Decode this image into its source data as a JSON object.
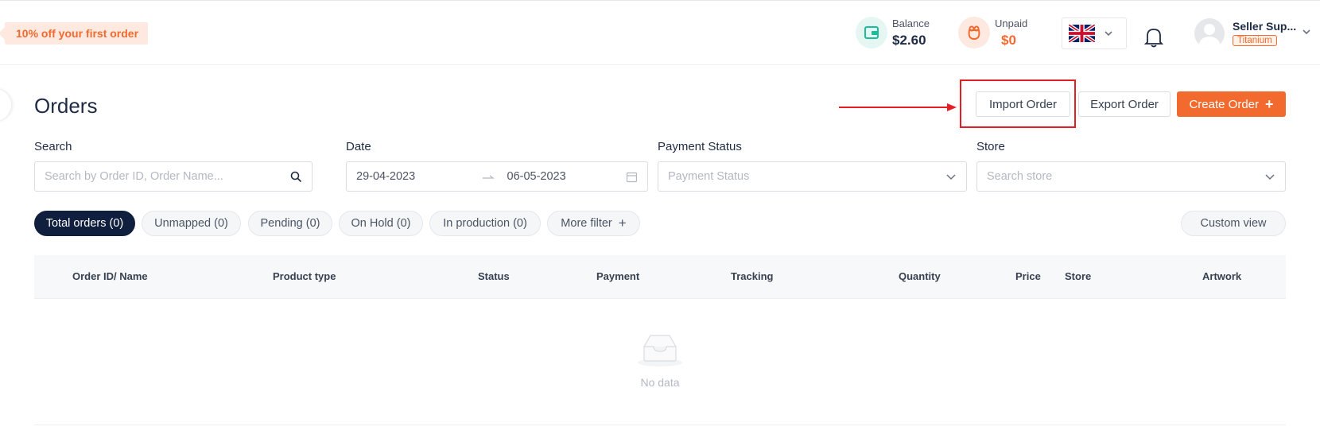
{
  "promo": {
    "text": "10% off your first order"
  },
  "wallet": {
    "balance": {
      "label": "Balance",
      "value": "$2.60",
      "color": "#1abc9c"
    },
    "unpaid": {
      "label": "Unpaid",
      "value": "$0",
      "color": "#f26a2e"
    }
  },
  "language": {
    "flag": "uk-flag-icon"
  },
  "user": {
    "name": "Seller Sup...",
    "tier": "Titanium"
  },
  "page": {
    "title": "Orders"
  },
  "actions": {
    "import_label": "Import Order",
    "export_label": "Export Order",
    "create_label": "Create Order",
    "create_icon": "+"
  },
  "filters": {
    "search": {
      "label": "Search",
      "placeholder": "Search by Order ID, Order Name..."
    },
    "date": {
      "label": "Date",
      "start": "29-04-2023",
      "end": "06-05-2023"
    },
    "payment": {
      "label": "Payment Status",
      "placeholder": "Payment Status"
    },
    "store": {
      "label": "Store",
      "placeholder": "Search store"
    }
  },
  "tabs": [
    {
      "label": "Total orders (0)",
      "active": true
    },
    {
      "label": "Unmapped (0)"
    },
    {
      "label": "Pending (0)"
    },
    {
      "label": "On Hold (0)"
    },
    {
      "label": "In production (0)"
    },
    {
      "label": "More filter"
    }
  ],
  "custom_view_label": "Custom view",
  "table": {
    "columns": [
      "Order ID/ Name",
      "Product type",
      "Status",
      "Payment",
      "Tracking",
      "Quantity",
      "Price",
      "Store",
      "Artwork"
    ],
    "empty_text": "No data"
  },
  "colors": {
    "accent": "#f26a2e",
    "navy": "#0f1f3d",
    "highlight": "#e31e24"
  }
}
